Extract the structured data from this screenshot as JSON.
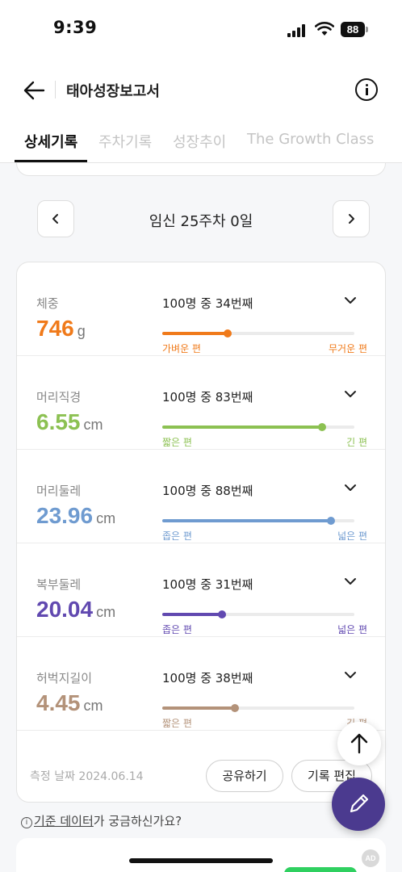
{
  "status_bar": {
    "time": "9:39",
    "battery": "88"
  },
  "header": {
    "title": "태아성장보고서"
  },
  "tabs": [
    {
      "label": "상세기록"
    },
    {
      "label": "주차기록"
    },
    {
      "label": "성장추이"
    },
    {
      "label": "The Growth Class"
    }
  ],
  "week_nav": {
    "label": "임신 25주차 0일"
  },
  "metrics": [
    {
      "name": "체중",
      "value": "746",
      "unit": "g",
      "rank": "100명 중 34번째",
      "percentile": 34,
      "low_label": "가벼운 편",
      "high_label": "무거운 편",
      "color": "#f07a1a"
    },
    {
      "name": "머리직경",
      "value": "6.55",
      "unit": "cm",
      "rank": "100명 중 83번째",
      "percentile": 83,
      "low_label": "짧은 편",
      "high_label": "긴 편",
      "color": "#8cc152"
    },
    {
      "name": "머리둘레",
      "value": "23.96",
      "unit": "cm",
      "rank": "100명 중 88번째",
      "percentile": 88,
      "low_label": "좁은 편",
      "high_label": "넓은 편",
      "color": "#6f9bd0"
    },
    {
      "name": "복부둘레",
      "value": "20.04",
      "unit": "cm",
      "rank": "100명 중 31번째",
      "percentile": 31,
      "low_label": "좁은 편",
      "high_label": "넓은 편",
      "color": "#6149b0"
    },
    {
      "name": "허벅지길이",
      "value": "4.45",
      "unit": "cm",
      "rank": "100명 중 38번째",
      "percentile": 38,
      "low_label": "짧은 편",
      "high_label": "긴 편",
      "color": "#b39279"
    }
  ],
  "footer": {
    "measure_date": "측정 날짜 2024.06.14",
    "share_label": "공유하기",
    "edit_label": "기록 편집"
  },
  "data_question": {
    "link_text": "기준 데이터",
    "rest_text": "가 궁금하신가요?"
  },
  "ad_badge": "AD",
  "icons": [
    "back-arrow-icon",
    "info-icon",
    "chevron-left-icon",
    "chevron-right-icon",
    "chevron-down-icon",
    "arrow-up-icon",
    "pencil-icon",
    "question-icon"
  ]
}
